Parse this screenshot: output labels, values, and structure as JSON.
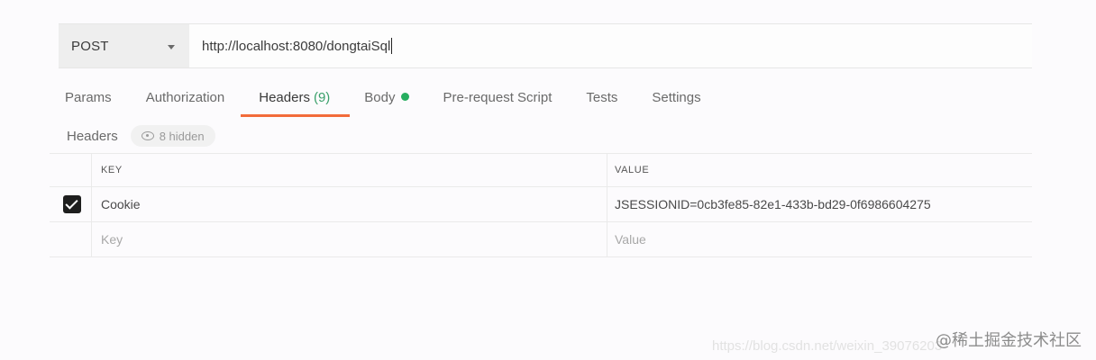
{
  "request": {
    "method": "POST",
    "url": "http://localhost:8080/dongtaiSql"
  },
  "tabs": [
    {
      "label": "Params"
    },
    {
      "label": "Authorization"
    },
    {
      "label": "Headers",
      "count": "(9)"
    },
    {
      "label": "Body"
    },
    {
      "label": "Pre-request Script"
    },
    {
      "label": "Tests"
    },
    {
      "label": "Settings"
    }
  ],
  "headers_section": {
    "title": "Headers",
    "hidden_label": "8 hidden"
  },
  "table": {
    "columns": [
      "KEY",
      "VALUE"
    ],
    "rows": [
      {
        "key": "Cookie",
        "value": "JSESSIONID=0cb3fe85-82e1-433b-bd29-0f6986604275"
      }
    ],
    "placeholder": {
      "key": "Key",
      "value": "Value"
    }
  },
  "watermark": {
    "url": "https://blog.csdn.net/weixin_39076203",
    "brand": "@稀土掘金技术社区"
  },
  "colors": {
    "active_tab_underline": "#f26b3a",
    "body_dot": "#27ae60",
    "header_count": "#3aa06b"
  }
}
